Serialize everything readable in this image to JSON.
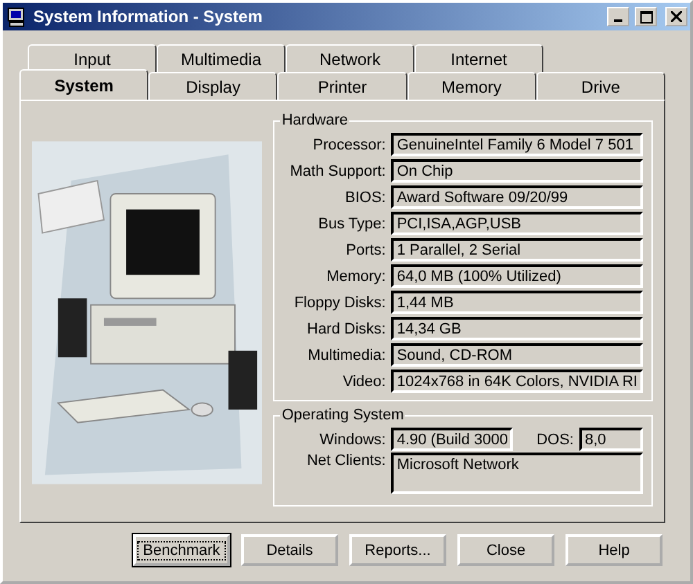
{
  "window": {
    "title": "System Information - System"
  },
  "tab_rows": [
    [
      {
        "label": "Input",
        "selected": false
      },
      {
        "label": "Multimedia",
        "selected": false
      },
      {
        "label": "Network",
        "selected": false
      },
      {
        "label": "Internet",
        "selected": false
      }
    ],
    [
      {
        "label": "System",
        "selected": true
      },
      {
        "label": "Display",
        "selected": false
      },
      {
        "label": "Printer",
        "selected": false
      },
      {
        "label": "Memory",
        "selected": false
      },
      {
        "label": "Drive",
        "selected": false
      }
    ]
  ],
  "hardware": {
    "title": "Hardware",
    "fields": [
      {
        "label": "Processor:",
        "value": "GenuineIntel Family 6 Model 7 501"
      },
      {
        "label": "Math Support:",
        "value": "On Chip"
      },
      {
        "label": "BIOS:",
        "value": "Award Software 09/20/99"
      },
      {
        "label": "Bus Type:",
        "value": "PCI,ISA,AGP,USB"
      },
      {
        "label": "Ports:",
        "value": "1 Parallel, 2 Serial"
      },
      {
        "label": "Memory:",
        "value": "64,0 MB  (100% Utilized)"
      },
      {
        "label": "Floppy Disks:",
        "value": "1,44 MB"
      },
      {
        "label": "Hard Disks:",
        "value": "14,34 GB"
      },
      {
        "label": "Multimedia:",
        "value": "Sound, CD-ROM"
      },
      {
        "label": "Video:",
        "value": "1024x768 in 64K Colors, NVIDIA RI"
      }
    ]
  },
  "operating_system": {
    "title": "Operating System",
    "windows": {
      "label": "Windows:",
      "value": "4.90 (Build 3000"
    },
    "dos": {
      "label": "DOS:",
      "value": "8,0"
    },
    "net_clients": {
      "label": "Net Clients:",
      "value": "Microsoft Network"
    }
  },
  "buttons": [
    {
      "label": "Benchmark",
      "focused": true
    },
    {
      "label": "Details",
      "focused": false
    },
    {
      "label": "Reports...",
      "focused": false
    },
    {
      "label": "Close",
      "focused": false
    },
    {
      "label": "Help",
      "focused": false
    }
  ]
}
